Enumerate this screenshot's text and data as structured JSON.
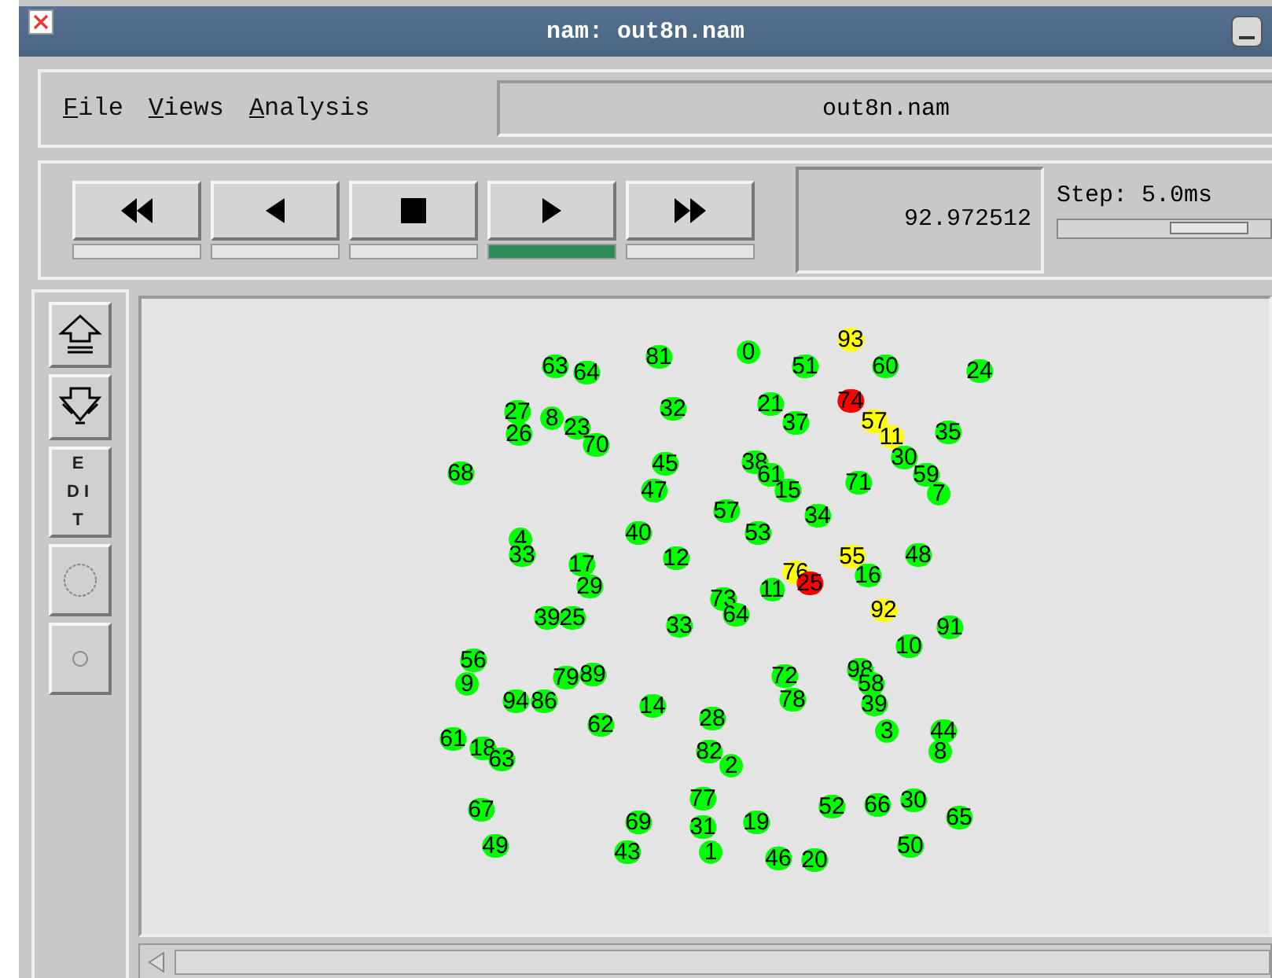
{
  "window": {
    "title": "nam: out8n.nam"
  },
  "menu": [
    "File",
    "Views",
    "Analysis"
  ],
  "file_label": "out8n.nam",
  "transport": [
    {
      "kind": "rewind",
      "selected": false
    },
    {
      "kind": "back",
      "selected": false
    },
    {
      "kind": "stop",
      "selected": false
    },
    {
      "kind": "play",
      "selected": true
    },
    {
      "kind": "forward",
      "selected": false
    }
  ],
  "time": "92.972512",
  "step": {
    "label": "Step: 5.0ms",
    "level": 0.72
  },
  "tools": [
    {
      "kind": "zoom-in"
    },
    {
      "kind": "zoom-out"
    },
    {
      "kind": "text",
      "label": "EDIT"
    },
    {
      "kind": "large-node"
    },
    {
      "kind": "small-node"
    }
  ],
  "nodes": [
    {
      "label": "93",
      "color": "#ffff00"
    },
    {
      "label": "63",
      "color": "#00ff00"
    },
    {
      "label": "81",
      "color": "#00ff00"
    },
    {
      "label": "0",
      "color": "#00ff00"
    },
    {
      "label": "64",
      "color": "#00ff00"
    },
    {
      "label": "51",
      "color": "#00ff00"
    },
    {
      "label": "60",
      "color": "#00ff00"
    },
    {
      "label": "24",
      "color": "#00ff00"
    },
    {
      "label": "27",
      "color": "#00ff00"
    },
    {
      "label": "8",
      "color": "#00ff00"
    },
    {
      "label": "32",
      "color": "#00ff00"
    },
    {
      "label": "21",
      "color": "#00ff00"
    },
    {
      "label": "74",
      "color": "#ff0000"
    },
    {
      "label": "26",
      "color": "#00ff00"
    },
    {
      "label": "23",
      "color": "#00ff00"
    },
    {
      "label": "37",
      "color": "#00ff00"
    },
    {
      "label": "57",
      "color": "#ffff00"
    },
    {
      "label": "70",
      "color": "#00ff00"
    },
    {
      "label": "11",
      "color": "#ffff00"
    },
    {
      "label": "35",
      "color": "#00ff00"
    },
    {
      "label": "68",
      "color": "#00ff00"
    },
    {
      "label": "45",
      "color": "#00ff00"
    },
    {
      "label": "38",
      "color": "#00ff00"
    },
    {
      "label": "30",
      "color": "#00ff00"
    },
    {
      "label": "61",
      "color": "#00ff00"
    },
    {
      "label": "47",
      "color": "#00ff00"
    },
    {
      "label": "15",
      "color": "#00ff00"
    },
    {
      "label": "71",
      "color": "#00ff00"
    },
    {
      "label": "59",
      "color": "#00ff00"
    },
    {
      "label": "7",
      "color": "#00ff00"
    },
    {
      "label": "57",
      "color": "#00ff00"
    },
    {
      "label": "34",
      "color": "#00ff00"
    },
    {
      "label": "4",
      "color": "#00ff00"
    },
    {
      "label": "40",
      "color": "#00ff00"
    },
    {
      "label": "53",
      "color": "#00ff00"
    },
    {
      "label": "33",
      "color": "#00ff00"
    },
    {
      "label": "17",
      "color": "#00ff00"
    },
    {
      "label": "12",
      "color": "#00ff00"
    },
    {
      "label": "55",
      "color": "#ffff00"
    },
    {
      "label": "48",
      "color": "#00ff00"
    },
    {
      "label": "76",
      "color": "#ffff00"
    },
    {
      "label": "29",
      "color": "#00ff00"
    },
    {
      "label": "73",
      "color": "#00ff00"
    },
    {
      "label": "11",
      "color": "#00ff00"
    },
    {
      "label": "25",
      "color": "#ff0000"
    },
    {
      "label": "16",
      "color": "#00ff00"
    },
    {
      "label": "39",
      "color": "#00ff00"
    },
    {
      "label": "25",
      "color": "#00ff00"
    },
    {
      "label": "33",
      "color": "#00ff00"
    },
    {
      "label": "64",
      "color": "#00ff00"
    },
    {
      "label": "92",
      "color": "#ffff00"
    },
    {
      "label": "91",
      "color": "#00ff00"
    },
    {
      "label": "10",
      "color": "#00ff00"
    },
    {
      "label": "56",
      "color": "#00ff00"
    },
    {
      "label": "9",
      "color": "#00ff00"
    },
    {
      "label": "79",
      "color": "#00ff00"
    },
    {
      "label": "89",
      "color": "#00ff00"
    },
    {
      "label": "72",
      "color": "#00ff00"
    },
    {
      "label": "98",
      "color": "#00ff00"
    },
    {
      "label": "58",
      "color": "#00ff00"
    },
    {
      "label": "94",
      "color": "#00ff00"
    },
    {
      "label": "86",
      "color": "#00ff00"
    },
    {
      "label": "14",
      "color": "#00ff00"
    },
    {
      "label": "78",
      "color": "#00ff00"
    },
    {
      "label": "39",
      "color": "#00ff00"
    },
    {
      "label": "62",
      "color": "#00ff00"
    },
    {
      "label": "28",
      "color": "#00ff00"
    },
    {
      "label": "61",
      "color": "#00ff00"
    },
    {
      "label": "18",
      "color": "#00ff00"
    },
    {
      "label": "3",
      "color": "#00ff00"
    },
    {
      "label": "44",
      "color": "#00ff00"
    },
    {
      "label": "63",
      "color": "#00ff00"
    },
    {
      "label": "82",
      "color": "#00ff00"
    },
    {
      "label": "8",
      "color": "#00ff00"
    },
    {
      "label": "2",
      "color": "#00ff00"
    },
    {
      "label": "67",
      "color": "#00ff00"
    },
    {
      "label": "77",
      "color": "#00ff00"
    },
    {
      "label": "52",
      "color": "#00ff00"
    },
    {
      "label": "66",
      "color": "#00ff00"
    },
    {
      "label": "30",
      "color": "#00ff00"
    },
    {
      "label": "69",
      "color": "#00ff00"
    },
    {
      "label": "31",
      "color": "#00ff00"
    },
    {
      "label": "19",
      "color": "#00ff00"
    },
    {
      "label": "65",
      "color": "#00ff00"
    },
    {
      "label": "49",
      "color": "#00ff00"
    },
    {
      "label": "43",
      "color": "#00ff00"
    },
    {
      "label": "1",
      "color": "#00ff00"
    },
    {
      "label": "46",
      "color": "#00ff00"
    },
    {
      "label": "20",
      "color": "#00ff00"
    },
    {
      "label": "50",
      "color": "#00ff00"
    }
  ]
}
